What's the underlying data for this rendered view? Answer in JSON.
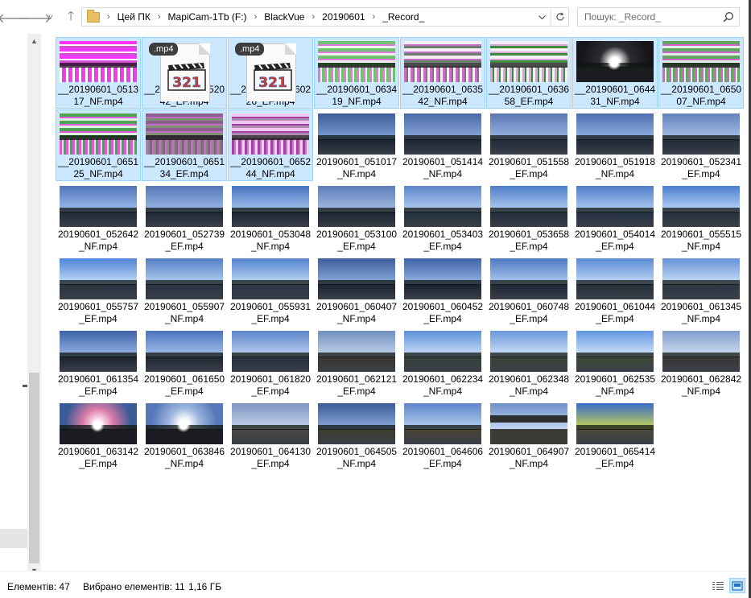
{
  "nav": {
    "back_glyph": "🡐",
    "forward_glyph": "🡒",
    "recent_glyph": "˅",
    "up_glyph": "🡑"
  },
  "address": {
    "crumbs": [
      "Цей ПК",
      "MapiCam-1Tb (F:)",
      "BlackVue",
      "20190601",
      "_Record_"
    ],
    "separator": "›"
  },
  "search": {
    "placeholder": "Пошук: _Record_"
  },
  "status": {
    "items_count": "Елементів: 47",
    "selected": "Вибрано елементів: 11",
    "size": "1,16 ГБ"
  },
  "colors": {
    "selection_bg": "#cce8ff",
    "selection_border": "#99d1ff",
    "accent": "#0078d7"
  },
  "files": [
    {
      "label": "__20190601_0513\n17_NF.mp4",
      "selected": true,
      "kind": "glitch",
      "c1": "#ff33ff",
      "c2": "#ffffff",
      "c3": "#d14fd1"
    },
    {
      "label": "__20190601_0520\n42_EF.mp4",
      "selected": true,
      "kind": "filetype",
      "ext": ".mp4"
    },
    {
      "label": "__20190601_0602\n26_EF.mp4",
      "selected": true,
      "kind": "filetype",
      "ext": ".mp4"
    },
    {
      "label": "__20190601_0634\n19_NF.mp4",
      "selected": true,
      "kind": "glitch",
      "c1": "#6fc26f",
      "c2": "#e07ae0",
      "c3": "#f0f0f0"
    },
    {
      "label": "__20190601_0635\n42_NF.mp4",
      "selected": true,
      "kind": "glitch",
      "c1": "#f4eef4",
      "c2": "#c76fc7",
      "c3": "#6d7e6d"
    },
    {
      "label": "__20190601_0636\n58_EF.mp4",
      "selected": true,
      "kind": "glitch",
      "c1": "#f5f0f5",
      "c2": "#d9a3d9",
      "c3": "#3b8d3b"
    },
    {
      "label": "__20190601_0644\n31_NF.mp4",
      "selected": true,
      "kind": "sunset",
      "c1": "#16161a",
      "c2": "#ffffff",
      "c3": "#2c2c34"
    },
    {
      "label": "__20190601_0650\n07_NF.mp4",
      "selected": true,
      "kind": "glitch",
      "c1": "#62a562",
      "c2": "#ce66ce",
      "c3": "#e6efe6"
    },
    {
      "label": "__20190601_0651\n25_NF.mp4",
      "selected": true,
      "kind": "glitch",
      "c1": "#4fa34f",
      "c2": "#e05ae0",
      "c3": "#e0f0e0"
    },
    {
      "label": "__20190601_0651\n34_EF.mp4",
      "selected": true,
      "kind": "glitch",
      "c1": "#8e5e8e",
      "c2": "#c070c0",
      "c3": "#7f8e6f"
    },
    {
      "label": "__20190601_0652\n44_NF.mp4",
      "selected": true,
      "kind": "glitch",
      "c1": "#f0c8f0",
      "c2": "#a442a4",
      "c3": "#b28bb2"
    },
    {
      "label": "20190601_051017\n_NF.mp4",
      "selected": false,
      "kind": "road",
      "c1": "#3f5f96",
      "c2": "#1a2233",
      "c3": "#7da0d6"
    },
    {
      "label": "20190601_051414\n_NF.mp4",
      "selected": false,
      "kind": "road",
      "c1": "#4a6aa3",
      "c2": "#1c2436",
      "c3": "#8ba9dd"
    },
    {
      "label": "20190601_051558\n_EF.mp4",
      "selected": false,
      "kind": "road",
      "c1": "#5b78b0",
      "c2": "#202a3a",
      "c3": "#9ab5e6"
    },
    {
      "label": "20190601_051918\n_NF.mp4",
      "selected": false,
      "kind": "road",
      "c1": "#4e70ae",
      "c2": "#1d2636",
      "c3": "#93b2e4"
    },
    {
      "label": "20190601_052341\n_EF.mp4",
      "selected": false,
      "kind": "road",
      "c1": "#6482bb",
      "c2": "#21293a",
      "c3": "#a8c1ea"
    },
    {
      "label": "20190601_052642\n_NF.mp4",
      "selected": false,
      "kind": "road",
      "c1": "#4f74b8",
      "c2": "#1f2838",
      "c3": "#a2c0ef"
    },
    {
      "label": "20190601_052739\n_EF.mp4",
      "selected": false,
      "kind": "road",
      "c1": "#5577b5",
      "c2": "#1f2636",
      "c3": "#9fbbe8"
    },
    {
      "label": "20190601_053048\n_NF.mp4",
      "selected": false,
      "kind": "road",
      "c1": "#4a73c0",
      "c2": "#1d2535",
      "c3": "#aac6f2"
    },
    {
      "label": "20190601_053100\n_EF.mp4",
      "selected": false,
      "kind": "road",
      "c1": "#5c7cb7",
      "c2": "#1d2333",
      "c3": "#a7bfe6"
    },
    {
      "label": "20190601_053403\n_EF.mp4",
      "selected": false,
      "kind": "road",
      "c1": "#5d86c9",
      "c2": "#22303d",
      "c3": "#b6d0f3"
    },
    {
      "label": "20190601_053658\n_EF.mp4",
      "selected": false,
      "kind": "road",
      "c1": "#4c7cc8",
      "c2": "#212b3a",
      "c3": "#b9d3f6"
    },
    {
      "label": "20190601_054014\n_EF.mp4",
      "selected": false,
      "kind": "road",
      "c1": "#4f7ec7",
      "c2": "#243144",
      "c3": "#b5cff4"
    },
    {
      "label": "20190601_055515\n_NF.mp4",
      "selected": false,
      "kind": "road",
      "c1": "#4a7dd0",
      "c2": "#25303e",
      "c3": "#c0d8f7"
    },
    {
      "label": "20190601_055757\n_EF.mp4",
      "selected": false,
      "kind": "road",
      "c1": "#4f84d6",
      "c2": "#2a3442",
      "c3": "#c6ddf8"
    },
    {
      "label": "20190601_055907\n_NF.mp4",
      "selected": false,
      "kind": "road",
      "c1": "#527ec5",
      "c2": "#283240",
      "c3": "#b8d0f1"
    },
    {
      "label": "20190601_055931\n_EF.mp4",
      "selected": false,
      "kind": "road",
      "c1": "#5384d0",
      "c2": "#2a3646",
      "c3": "#c2d9f6"
    },
    {
      "label": "20190601_060407\n_NF.mp4",
      "selected": false,
      "kind": "road",
      "c1": "#3d5e9a",
      "c2": "#1b2431",
      "c3": "#8eaddd"
    },
    {
      "label": "20190601_060452\n_EF.mp4",
      "selected": false,
      "kind": "road",
      "c1": "#3f63a5",
      "c2": "#1a2230",
      "c3": "#96b6e6"
    },
    {
      "label": "20190601_060748\n_EF.mp4",
      "selected": false,
      "kind": "road",
      "c1": "#4c78c3",
      "c2": "#1d2735",
      "c3": "#b2cdf1"
    },
    {
      "label": "20190601_061044\n_EF.mp4",
      "selected": false,
      "kind": "road",
      "c1": "#5989d4",
      "c2": "#23303c",
      "c3": "#c5dbf8"
    },
    {
      "label": "20190601_061345\n_NF.mp4",
      "selected": false,
      "kind": "road",
      "c1": "#6591d6",
      "c2": "#2c3845",
      "c3": "#cde0f8"
    },
    {
      "label": "20190601_061354\n_EF.mp4",
      "selected": false,
      "kind": "road",
      "c1": "#3d63a6",
      "c2": "#1c2330",
      "c3": "#9ab8e6"
    },
    {
      "label": "20190601_061650\n_EF.mp4",
      "selected": false,
      "kind": "road",
      "c1": "#4a74bd",
      "c2": "#1f2733",
      "c3": "#a8c4ee"
    },
    {
      "label": "20190601_061820\n_EF.mp4",
      "selected": false,
      "kind": "road",
      "c1": "#5c85cb",
      "c2": "#26303c",
      "c3": "#bdd3f2"
    },
    {
      "label": "20190601_062121\n_EF.mp4",
      "selected": false,
      "kind": "road",
      "c1": "#6f8fbf",
      "c2": "#3a3632",
      "c3": "#c7d6ea"
    },
    {
      "label": "20190601_062234\n_NF.mp4",
      "selected": false,
      "kind": "road",
      "c1": "#5f8fd8",
      "c2": "#35403a",
      "c3": "#cfe2f9"
    },
    {
      "label": "20190601_062348\n_NF.mp4",
      "selected": false,
      "kind": "road",
      "c1": "#6a98dc",
      "c2": "#394236",
      "c3": "#d4e5fa"
    },
    {
      "label": "20190601_062535\n_NF.mp4",
      "selected": false,
      "kind": "road",
      "c1": "#6196e2",
      "c2": "#3b4a34",
      "c3": "#d8e8fb"
    },
    {
      "label": "20190601_062842\n_NF.mp4",
      "selected": false,
      "kind": "road",
      "c1": "#7f9ccb",
      "c2": "#3a3835",
      "c3": "#d3e0f1"
    },
    {
      "label": "20190601_063142\n_EF.mp4",
      "selected": false,
      "kind": "sunset",
      "c1": "#3a5a98",
      "c2": "#ffe0f0",
      "c3": "#d87aa6"
    },
    {
      "label": "20190601_063846\n_NF.mp4",
      "selected": false,
      "kind": "sunset",
      "c1": "#5578b8",
      "c2": "#ffffff",
      "c3": "#9fb7e0"
    },
    {
      "label": "20190601_064130\n_EF.mp4",
      "selected": false,
      "kind": "road",
      "c1": "#7e96c2",
      "c2": "#4a4744",
      "c3": "#c6d3ea"
    },
    {
      "label": "20190601_064505\n_NF.mp4",
      "selected": false,
      "kind": "road",
      "c1": "#3b5b96",
      "c2": "#3c3e2c",
      "c3": "#8eacdc"
    },
    {
      "label": "20190601_064606\n_EF.mp4",
      "selected": false,
      "kind": "road",
      "c1": "#5f86c8",
      "c2": "#4a4236",
      "c3": "#b7cff0"
    },
    {
      "label": "20190601_064907\n_NF.mp4",
      "selected": false,
      "kind": "bridge",
      "c1": "#6d8fc9",
      "c2": "#3a3d36",
      "c3": "#c3d6f2"
    },
    {
      "label": "20190601_065414\n_EF.mp4",
      "selected": false,
      "kind": "road",
      "c1": "#3a6cc9",
      "c2": "#4a4a3a",
      "c3": "#c9d64f"
    }
  ]
}
